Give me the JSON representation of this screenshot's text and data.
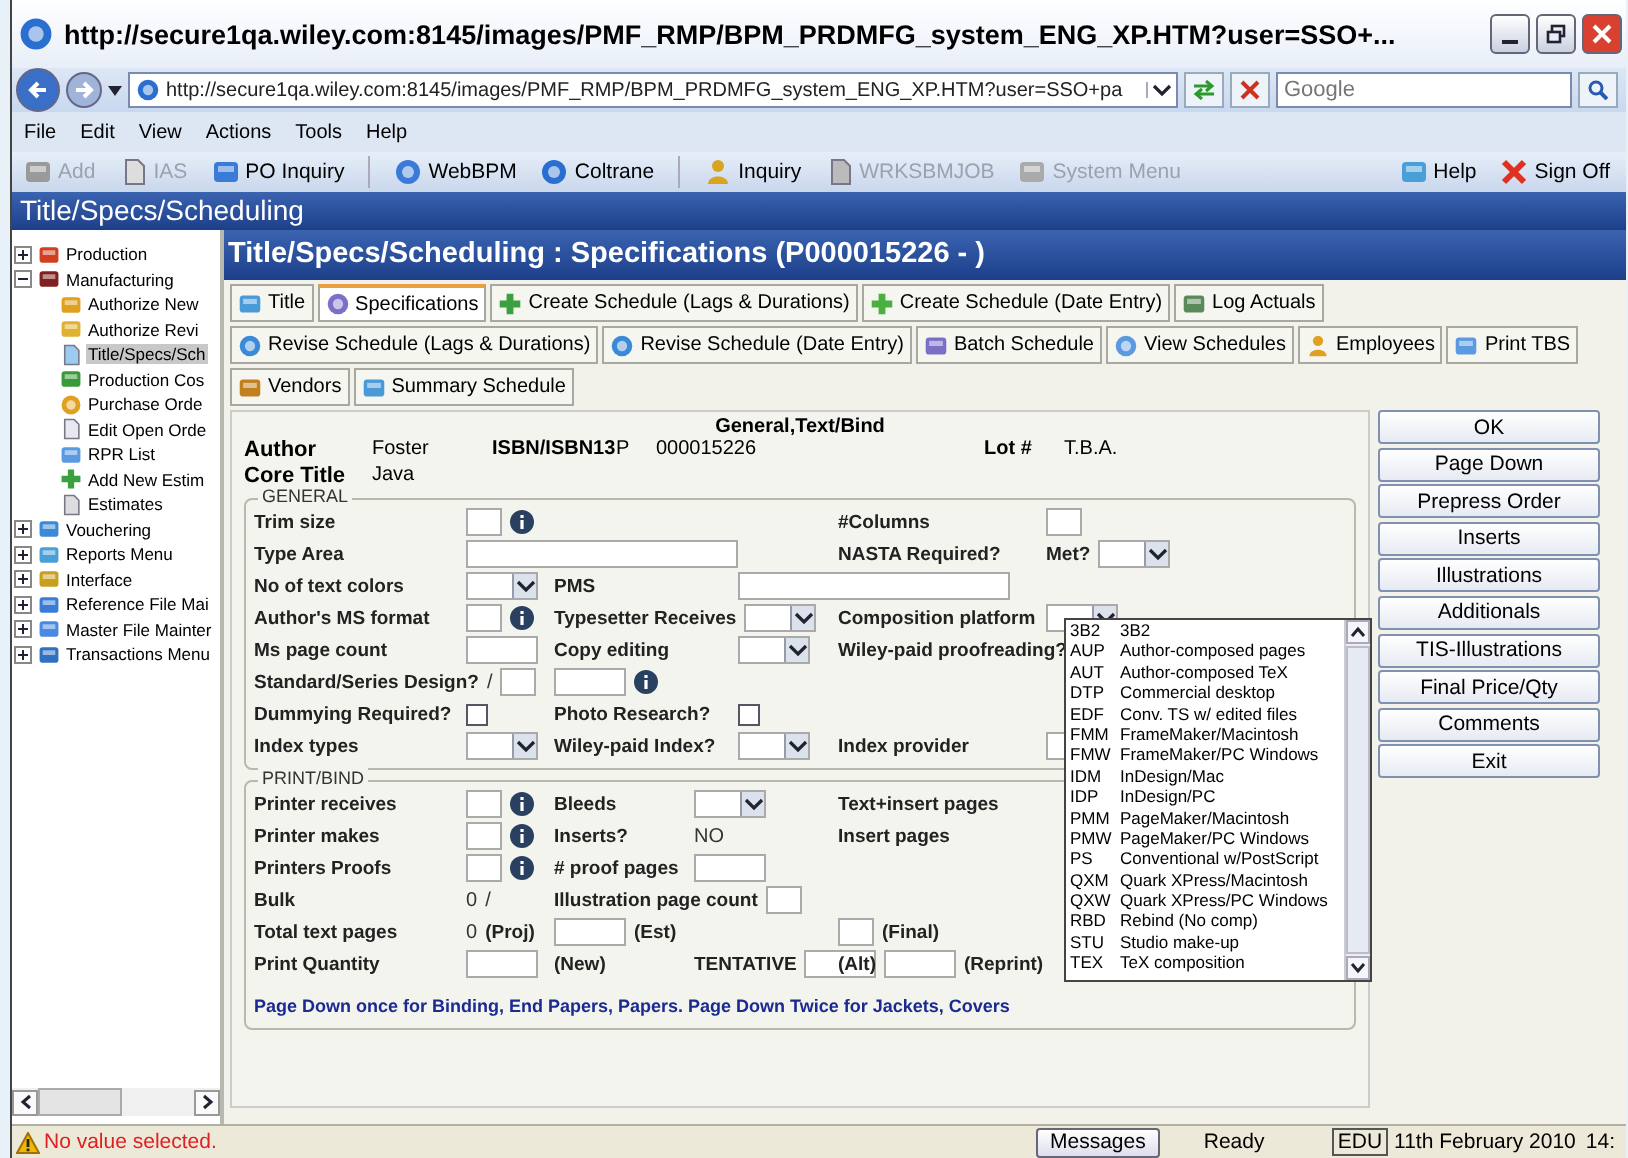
{
  "window": {
    "title": "http://secure1qa.wiley.com:8145/images/PMF_RMP/BPM_PRDMFG_system_ENG_XP.HTM?user=SSO+..."
  },
  "address_bar": {
    "url": "http://secure1qa.wiley.com:8145/images/PMF_RMP/BPM_PRDMFG_system_ENG_XP.HTM?user=SSO+pa"
  },
  "search": {
    "placeholder": "Google"
  },
  "menu": [
    "File",
    "Edit",
    "View",
    "Actions",
    "Tools",
    "Help"
  ],
  "toolbar": [
    {
      "label": "Add",
      "disabled": true
    },
    {
      "label": "IAS",
      "disabled": true
    },
    {
      "label": "PO Inquiry",
      "disabled": false
    },
    {
      "label": "WebBPM",
      "disabled": false
    },
    {
      "label": "Coltrane",
      "disabled": false
    },
    {
      "label": "Inquiry",
      "disabled": false
    },
    {
      "label": "WRKSBMJOB",
      "disabled": true
    },
    {
      "label": "System Menu",
      "disabled": true
    },
    {
      "label": "Help",
      "disabled": false
    },
    {
      "label": "Sign Off",
      "disabled": false
    }
  ],
  "app_title": "Title/Specs/Scheduling",
  "sidebar": {
    "items": [
      {
        "label": "Production",
        "expanded": false,
        "selected": false
      },
      {
        "label": "Manufacturing",
        "expanded": true,
        "selected": false,
        "children": [
          {
            "label": "Authorize New",
            "selected": false
          },
          {
            "label": "Authorize Revi",
            "selected": false
          },
          {
            "label": "Title/Specs/Sch",
            "selected": true
          },
          {
            "label": "Production Cos",
            "selected": false
          },
          {
            "label": "Purchase Orde",
            "selected": false
          },
          {
            "label": "Edit Open Orde",
            "selected": false
          },
          {
            "label": "RPR List",
            "selected": false
          },
          {
            "label": "Add New Estim",
            "selected": false
          },
          {
            "label": "Estimates",
            "selected": false
          }
        ]
      },
      {
        "label": "Vouchering",
        "expanded": false,
        "selected": false
      },
      {
        "label": "Reports Menu",
        "expanded": false,
        "selected": false
      },
      {
        "label": "Interface",
        "expanded": false,
        "selected": false
      },
      {
        "label": "Reference File Mai",
        "expanded": false,
        "selected": false
      },
      {
        "label": "Master File Mainter",
        "expanded": false,
        "selected": false
      },
      {
        "label": "Transactions Menu",
        "expanded": false,
        "selected": false
      }
    ]
  },
  "page": {
    "heading": "Title/Specs/Scheduling : Specifications (P000015226 - )",
    "tab_rows": [
      [
        {
          "label": "Title",
          "selected": false
        },
        {
          "label": "Specifications",
          "selected": true
        },
        {
          "label": "Create Schedule (Lags & Durations)",
          "selected": false
        },
        {
          "label": "Create Schedule (Date Entry)",
          "selected": false
        },
        {
          "label": "Log Actuals",
          "selected": false
        }
      ],
      [
        {
          "label": "Revise Schedule (Lags & Durations)",
          "selected": false
        },
        {
          "label": "Revise Schedule (Date Entry)",
          "selected": false
        },
        {
          "label": "Batch Schedule",
          "selected": false
        },
        {
          "label": "View Schedules",
          "selected": false
        },
        {
          "label": "Employees",
          "selected": false
        },
        {
          "label": "Print TBS",
          "selected": false
        }
      ],
      [
        {
          "label": "Vendors",
          "selected": false
        },
        {
          "label": "Summary Schedule",
          "selected": false
        }
      ]
    ]
  },
  "form": {
    "section_title": "General,Text/Bind",
    "header": [
      [
        {
          "kind": "label",
          "text": "Author"
        },
        {
          "kind": "value",
          "text": "Foster"
        },
        {
          "kind": "label",
          "text": "ISBN/ISBN13"
        },
        {
          "kind": "value",
          "text": "P"
        },
        {
          "kind": "value",
          "text": "000015226"
        },
        {
          "kind": "label",
          "text": "Lot #"
        },
        {
          "kind": "value",
          "text": "T.B.A."
        }
      ],
      [
        {
          "kind": "label",
          "text": "Core Title"
        },
        {
          "kind": "value",
          "text": "Java"
        }
      ]
    ],
    "fieldsets": [
      {
        "legend": "GENERAL",
        "rows": [
          {
            "a": [
              {
                "kind": "label",
                "text": "Trim size"
              },
              {
                "kind": "input"
              },
              {
                "kind": "info"
              }
            ],
            "c": [
              {
                "kind": "label",
                "text": "#Columns"
              },
              {
                "kind": "input"
              }
            ]
          },
          {
            "a": [
              {
                "kind": "label",
                "text": "Type Area"
              },
              {
                "kind": "long-input"
              }
            ],
            "c": [
              {
                "kind": "label",
                "text": "NASTA Required?"
              },
              {
                "kind": "label",
                "text": "Met?"
              },
              {
                "kind": "select"
              }
            ]
          },
          {
            "a": [
              {
                "kind": "label",
                "text": "No of text colors"
              },
              {
                "kind": "select"
              }
            ],
            "b": [
              {
                "kind": "label",
                "text": "PMS"
              },
              {
                "kind": "long-input"
              }
            ]
          },
          {
            "a": [
              {
                "kind": "label",
                "text": "Author's MS format"
              },
              {
                "kind": "input"
              },
              {
                "kind": "info"
              }
            ],
            "b": [
              {
                "kind": "label",
                "text": "Typesetter Receives"
              },
              {
                "kind": "select"
              }
            ],
            "c": [
              {
                "kind": "label",
                "text": "Composition platform"
              },
              {
                "kind": "select"
              }
            ]
          },
          {
            "a": [
              {
                "kind": "label",
                "text": "Ms page count"
              },
              {
                "kind": "wide-input"
              }
            ],
            "b": [
              {
                "kind": "label",
                "text": "Copy editing"
              },
              {
                "kind": "select"
              }
            ],
            "c": [
              {
                "kind": "label",
                "text": "Wiley-paid proofreading?"
              }
            ]
          },
          {
            "a": [
              {
                "kind": "label",
                "text": "Standard/Series Design?"
              },
              {
                "kind": "value",
                "text": "/"
              },
              {
                "kind": "input"
              }
            ],
            "b": [
              {
                "kind": "wide-input"
              },
              {
                "kind": "info"
              }
            ]
          },
          {
            "a": [
              {
                "kind": "label",
                "text": "Dummying Required?"
              },
              {
                "kind": "checkbox",
                "checked": false
              }
            ],
            "b": [
              {
                "kind": "label",
                "text": "Photo Research?"
              },
              {
                "kind": "checkbox",
                "checked": false
              }
            ]
          },
          {
            "a": [
              {
                "kind": "label",
                "text": "Index types"
              },
              {
                "kind": "select"
              }
            ],
            "b": [
              {
                "kind": "label",
                "text": "Wiley-paid Index?"
              },
              {
                "kind": "select"
              }
            ],
            "c": [
              {
                "kind": "label",
                "text": "Index provider"
              },
              {
                "kind": "select"
              }
            ]
          }
        ]
      },
      {
        "legend": "PRINT/BIND",
        "rows": [
          {
            "a": [
              {
                "kind": "label",
                "text": "Printer receives"
              },
              {
                "kind": "input"
              },
              {
                "kind": "info"
              }
            ],
            "b": [
              {
                "kind": "label",
                "text": "Bleeds"
              },
              {
                "kind": "select"
              }
            ],
            "c": [
              {
                "kind": "label",
                "text": "Text+insert pages"
              }
            ]
          },
          {
            "a": [
              {
                "kind": "label",
                "text": "Printer makes"
              },
              {
                "kind": "input"
              },
              {
                "kind": "info"
              }
            ],
            "b": [
              {
                "kind": "label",
                "text": "Inserts?"
              },
              {
                "kind": "value",
                "text": "NO"
              }
            ],
            "c": [
              {
                "kind": "label",
                "text": "Insert pages"
              }
            ]
          },
          {
            "a": [
              {
                "kind": "label",
                "text": "Printers Proofs"
              },
              {
                "kind": "input"
              },
              {
                "kind": "info"
              }
            ],
            "b": [
              {
                "kind": "label",
                "text": "# proof pages"
              },
              {
                "kind": "wide-input"
              }
            ]
          },
          {
            "a": [
              {
                "kind": "label",
                "text": "Bulk"
              },
              {
                "kind": "value",
                "text": "0"
              },
              {
                "kind": "value",
                "text": "/"
              }
            ],
            "b": [
              {
                "kind": "label",
                "text": "Illustration page count"
              },
              {
                "kind": "input"
              }
            ]
          },
          {
            "a": [
              {
                "kind": "label",
                "text": "Total text pages"
              },
              {
                "kind": "value",
                "text": "0"
              },
              {
                "kind": "label",
                "text": "(Proj)"
              }
            ],
            "b": [
              {
                "kind": "wide-input"
              },
              {
                "kind": "label",
                "text": "(Est)"
              }
            ],
            "c": [
              {
                "kind": "input"
              },
              {
                "kind": "label",
                "text": "(Final)"
              }
            ]
          },
          {
            "a": [
              {
                "kind": "label",
                "text": "Print Quantity"
              },
              {
                "kind": "wide-input"
              }
            ],
            "b": [
              {
                "kind": "label",
                "text": "(New)"
              },
              {
                "kind": "label",
                "text": "TENTATIVE"
              },
              {
                "kind": "wide-input"
              }
            ],
            "c": [
              {
                "kind": "label",
                "text": "(Alt)"
              },
              {
                "kind": "wide-input"
              },
              {
                "kind": "label",
                "text": "(Reprint)"
              }
            ]
          }
        ]
      }
    ],
    "note": "Page Down once for Binding, End Papers, Papers. Page Down Twice for Jackets, Covers"
  },
  "dropdown": {
    "options": [
      {
        "code": "3B2",
        "label": "3B2",
        "selected": false
      },
      {
        "code": "AUP",
        "label": "Author-composed pages",
        "selected": false
      },
      {
        "code": "AUT",
        "label": "Author-composed TeX",
        "selected": false
      },
      {
        "code": "DTP",
        "label": "Commercial desktop",
        "selected": false
      },
      {
        "code": "EDF",
        "label": "Conv. TS w/ edited files",
        "selected": false
      },
      {
        "code": "FMM",
        "label": "FrameMaker/Macintosh",
        "selected": false
      },
      {
        "code": "FMW",
        "label": "FrameMaker/PC Windows",
        "selected": false
      },
      {
        "code": "IDM",
        "label": "InDesign/Mac",
        "selected": false
      },
      {
        "code": "IDP",
        "label": "InDesign/PC",
        "selected": false
      },
      {
        "code": "PMM",
        "label": "PageMaker/Macintosh",
        "selected": false
      },
      {
        "code": "PMW",
        "label": "PageMaker/PC Windows",
        "selected": false
      },
      {
        "code": "PS",
        "label": "Conventional w/PostScript",
        "selected": false
      },
      {
        "code": "QXM",
        "label": "Quark XPress/Macintosh",
        "selected": false
      },
      {
        "code": "QXW",
        "label": "Quark XPress/PC Windows",
        "selected": false
      },
      {
        "code": "RBD",
        "label": "Rebind (No comp)",
        "selected": false
      },
      {
        "code": "STU",
        "label": "Studio make-up",
        "selected": false
      },
      {
        "code": "TEX",
        "label": "TeX composition",
        "selected": false
      }
    ]
  },
  "actions": [
    "OK",
    "Page Down",
    "Prepress Order",
    "Inserts",
    "Illustrations",
    "Additionals",
    "TIS-Illustrations",
    "Final Price/Qty",
    "Comments",
    "Exit"
  ],
  "status_bar": {
    "message": "No value selected.",
    "button": "Messages",
    "state": "Ready",
    "mode": "EDU",
    "date": "11th February 2010",
    "time": "14:"
  }
}
